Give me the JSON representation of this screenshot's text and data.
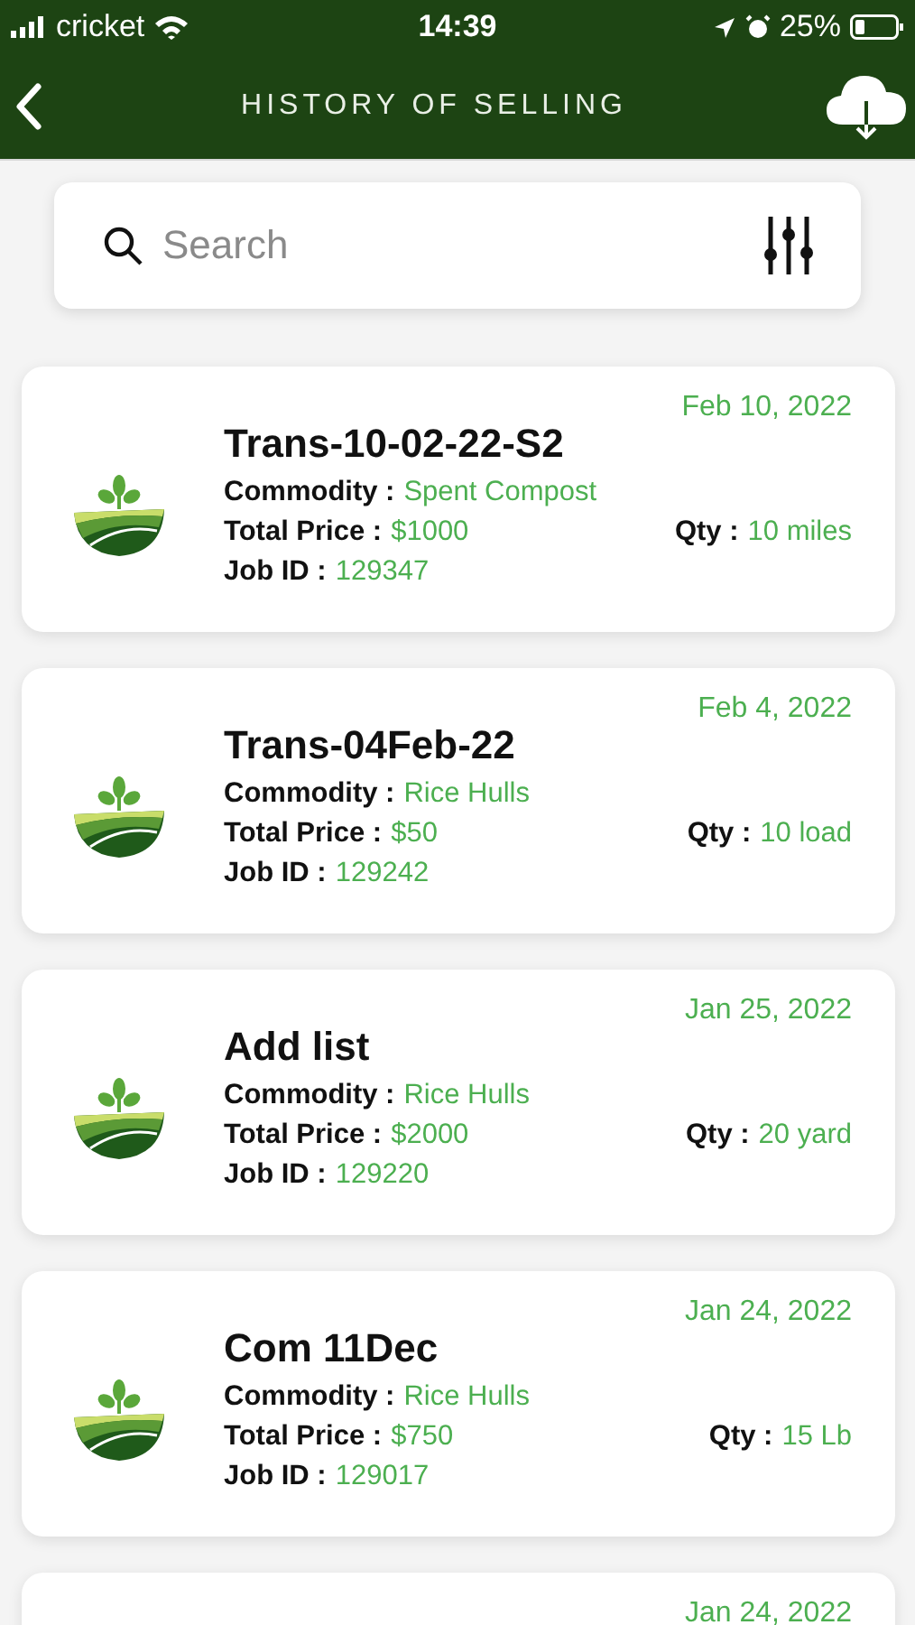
{
  "status_bar": {
    "carrier": "cricket",
    "time": "14:39",
    "battery": "25%"
  },
  "header": {
    "title": "HISTORY OF SELLING"
  },
  "search": {
    "placeholder": "Search"
  },
  "cards": [
    {
      "date": "Feb 10, 2022",
      "title": "Trans-10-02-22-S2",
      "commodity": {
        "label": "Commodity :",
        "value": "Spent Compost"
      },
      "price": {
        "label": "Total Price :",
        "value": "$1000"
      },
      "qty": {
        "label": "Qty :",
        "value": "10 miles"
      },
      "job": {
        "label": "Job ID :",
        "value": "129347"
      }
    },
    {
      "date": "Feb 4, 2022",
      "title": "Trans-04Feb-22",
      "commodity": {
        "label": "Commodity :",
        "value": "Rice Hulls"
      },
      "price": {
        "label": "Total Price :",
        "value": "$50"
      },
      "qty": {
        "label": "Qty :",
        "value": "10 load"
      },
      "job": {
        "label": "Job ID :",
        "value": "129242"
      }
    },
    {
      "date": "Jan 25, 2022",
      "title": "Add list",
      "commodity": {
        "label": "Commodity :",
        "value": "Rice Hulls"
      },
      "price": {
        "label": "Total Price :",
        "value": "$2000"
      },
      "qty": {
        "label": "Qty :",
        "value": "20 yard"
      },
      "job": {
        "label": "Job ID :",
        "value": "129220"
      }
    },
    {
      "date": "Jan 24, 2022",
      "title": "Com 11Dec",
      "commodity": {
        "label": "Commodity :",
        "value": "Rice Hulls"
      },
      "price": {
        "label": "Total Price :",
        "value": "$750"
      },
      "qty": {
        "label": "Qty :",
        "value": "15 Lb"
      },
      "job": {
        "label": "Job ID :",
        "value": "129017"
      }
    },
    {
      "date": "Jan 24, 2022"
    }
  ]
}
